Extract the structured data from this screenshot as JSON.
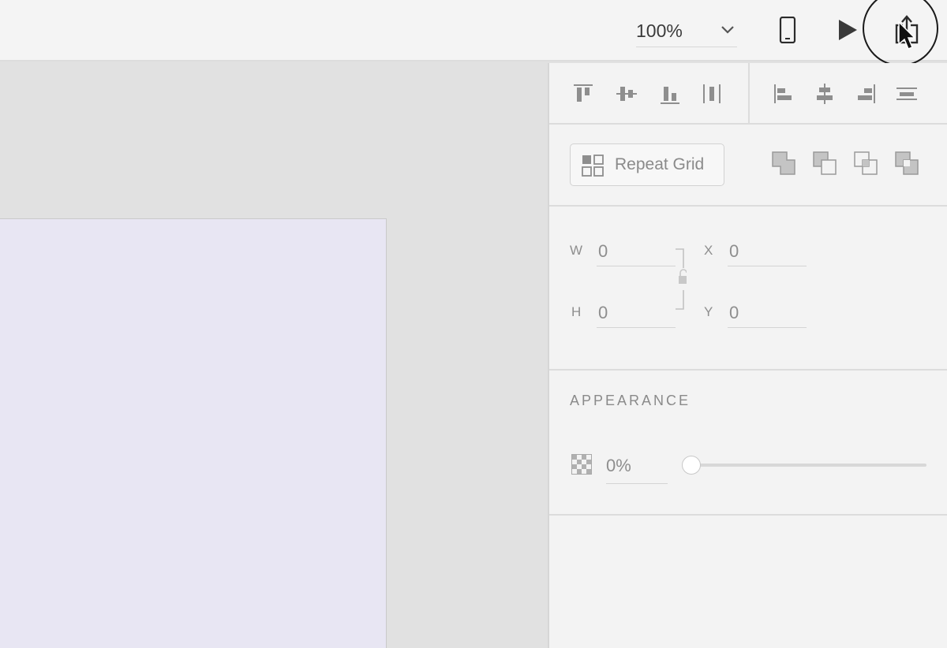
{
  "toolbar": {
    "zoom_value": "100%",
    "icons": [
      "chevron-down-icon",
      "device-preview-icon",
      "play-icon",
      "share-icon"
    ]
  },
  "panel": {
    "align": {
      "buttons": [
        "align-top-icon",
        "align-middle-icon",
        "align-bottom-icon",
        "distribute-vertical-icon",
        "align-left-icon",
        "align-center-icon",
        "align-right-icon",
        "distribute-horizontal-icon"
      ]
    },
    "repeat_grid": {
      "label": "Repeat Grid"
    },
    "boolean_ops": [
      "union-icon",
      "subtract-icon",
      "intersect-icon",
      "exclude-overlap-icon"
    ],
    "transform": {
      "w_label": "W",
      "w_value": "0",
      "h_label": "H",
      "h_value": "0",
      "x_label": "X",
      "x_value": "0",
      "y_label": "Y",
      "y_value": "0"
    },
    "appearance": {
      "title": "APPEARANCE",
      "opacity_value": "0%",
      "opacity_level": 0
    }
  },
  "colors": {
    "toolbar_bg": "#f4f4f4",
    "canvas_bg": "#e1e1e1",
    "artboard_fill": "#e8e6f3",
    "panel_bg": "#f3f3f3",
    "icon_gray": "#8e8e8e"
  }
}
